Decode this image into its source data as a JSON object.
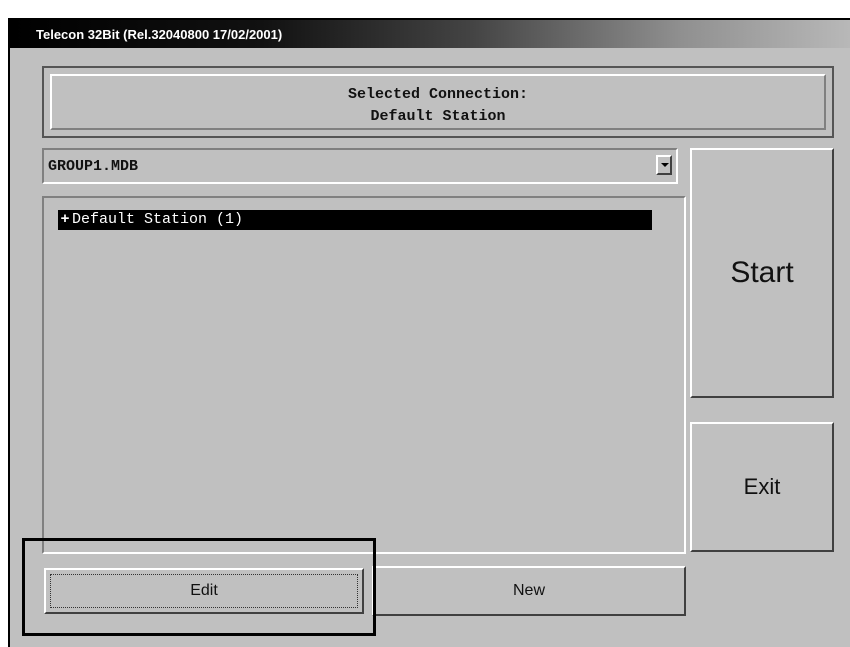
{
  "window": {
    "title": "Telecon 32Bit (Rel.32040800 17/02/2001)"
  },
  "connection": {
    "label": "Selected Connection:",
    "value": "Default Station"
  },
  "database_select": {
    "value": "GROUP1.MDB"
  },
  "tree": {
    "items": [
      {
        "expander": "+",
        "label": "Default Station (1)"
      }
    ]
  },
  "buttons": {
    "start": "Start",
    "exit": "Exit",
    "edit": "Edit",
    "new": "New"
  }
}
